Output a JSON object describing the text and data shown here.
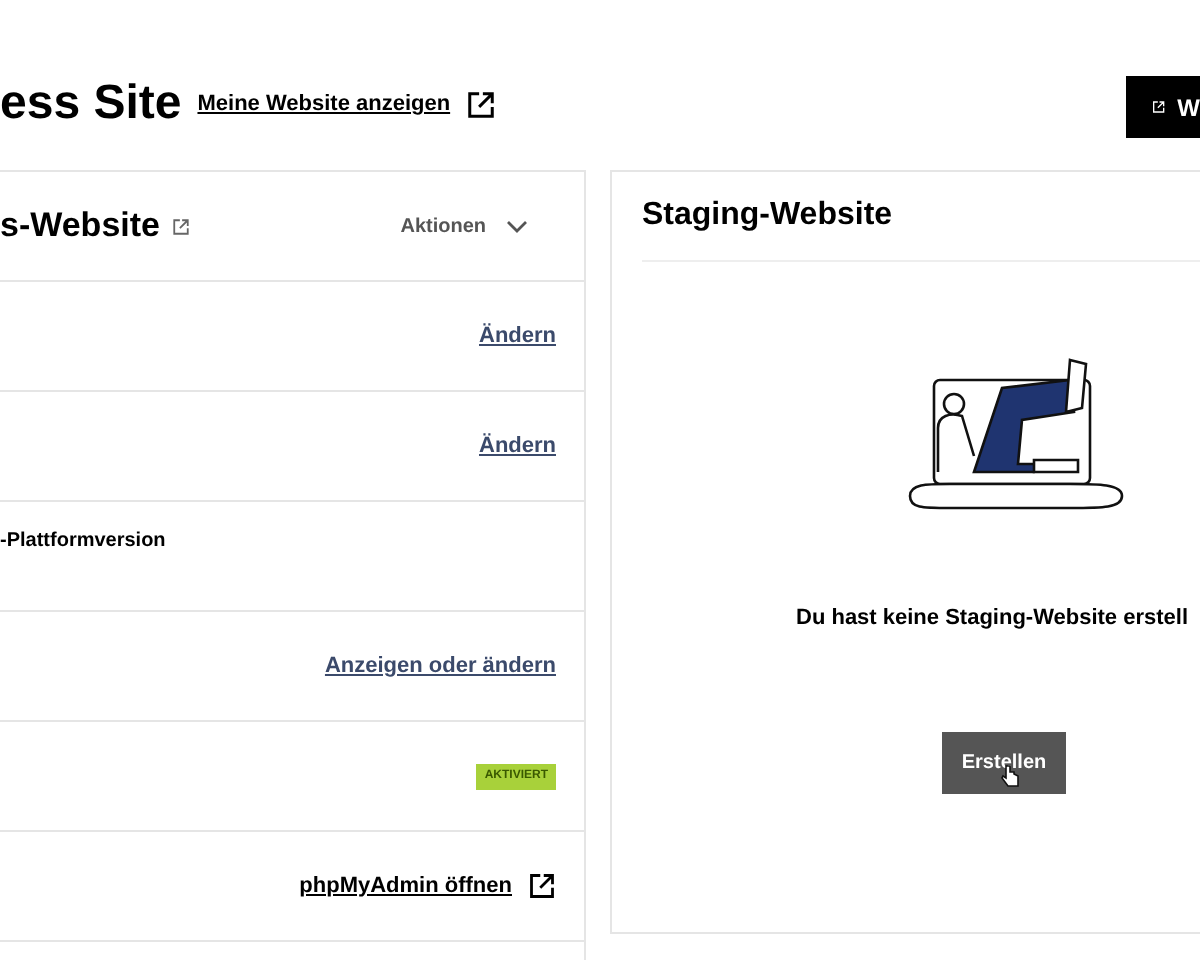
{
  "header": {
    "title": "ess Site",
    "view_link": "Meine Website anzeigen",
    "button": "W"
  },
  "site_card": {
    "title": "s-Website",
    "actions": "Aktionen",
    "rows": [
      {
        "kind": "action",
        "text": "Ändern"
      },
      {
        "kind": "action",
        "text": "Ändern"
      },
      {
        "kind": "label",
        "text": "-Plattformversion"
      },
      {
        "kind": "action",
        "text": "Anzeigen oder ändern"
      },
      {
        "kind": "badge",
        "text": "AKTIVIERT"
      },
      {
        "kind": "external",
        "text": "phpMyAdmin öffnen"
      }
    ]
  },
  "staging_card": {
    "title": "Staging-Website",
    "message": "Du hast keine Staging-Website erstell",
    "button": "Erstellen"
  }
}
